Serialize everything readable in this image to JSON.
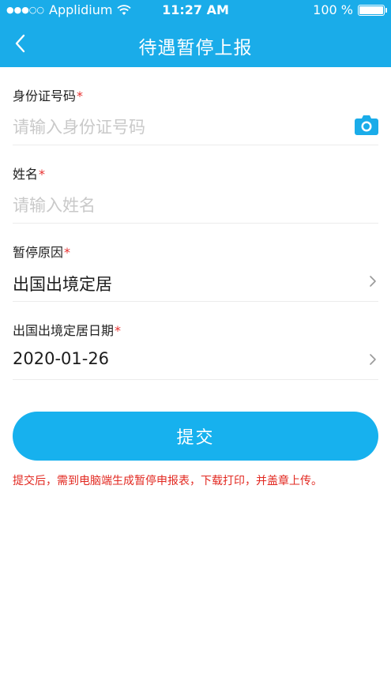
{
  "status_bar": {
    "carrier": "Applidium",
    "time": "11:27 AM",
    "battery": "100 %"
  },
  "nav": {
    "title": "待遇暂停上报",
    "back_icon": "chevron-left-icon"
  },
  "form": {
    "id_card": {
      "label": "身份证号码",
      "required_mark": "*",
      "placeholder": "请输入身份证号码",
      "icon": "camera-icon"
    },
    "name": {
      "label": "姓名",
      "required_mark": "*",
      "placeholder": "请输入姓名"
    },
    "reason": {
      "label": "暂停原因",
      "required_mark": "*",
      "value": "出国出境定居"
    },
    "date": {
      "label": "出国出境定居日期",
      "required_mark": "*",
      "value": "2020-01-26"
    }
  },
  "submit_label": "提交",
  "notice": "提交后，需到电脑端生成暂停申报表，下载打印，并盖章上传。",
  "colors": {
    "brand": "#1aace9",
    "button": "#17b1ee",
    "required": "#e8302f",
    "notice": "#e22820"
  }
}
